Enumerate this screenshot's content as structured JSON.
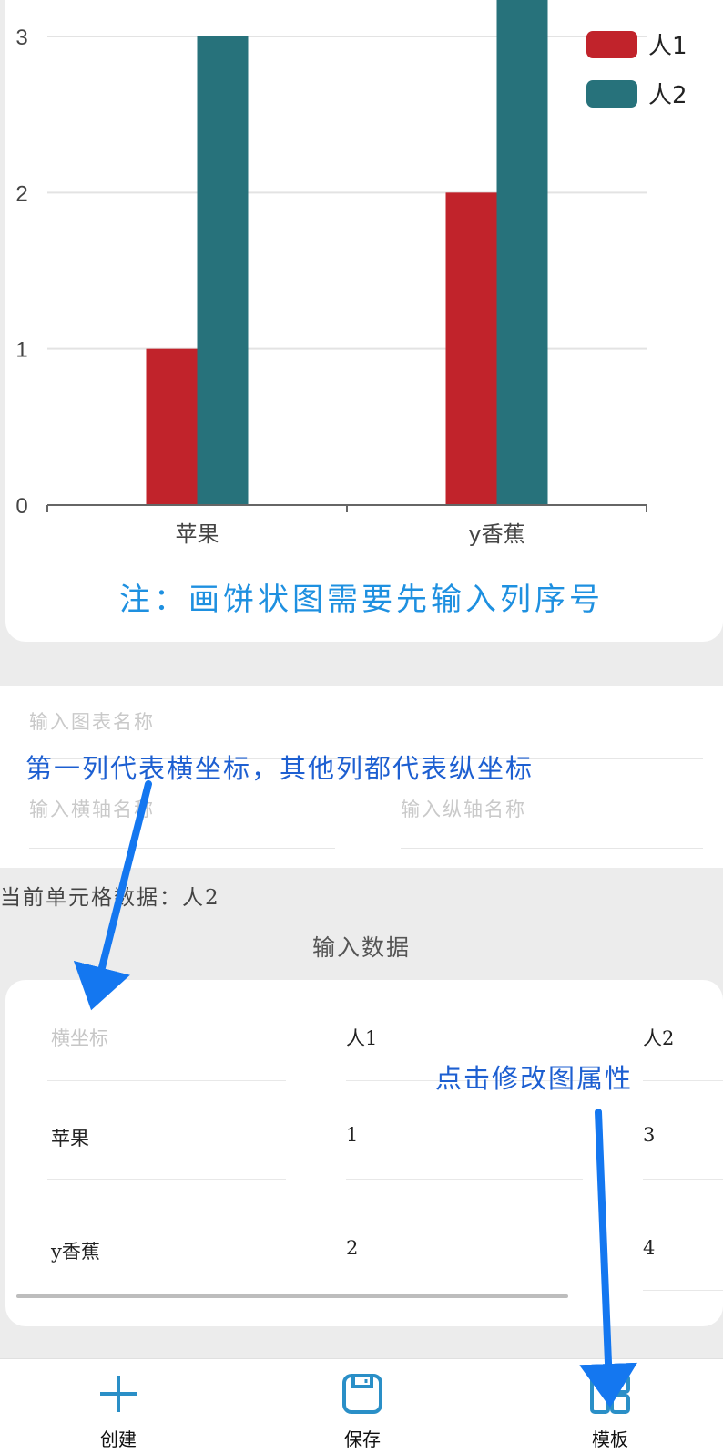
{
  "chart_data": {
    "type": "bar",
    "categories": [
      "苹果",
      "y香蕉"
    ],
    "series": [
      {
        "name": "人1",
        "values": [
          1,
          2
        ],
        "color": "#c1232b"
      },
      {
        "name": "人2",
        "values": [
          3,
          4
        ],
        "color": "#27727b"
      }
    ],
    "y_ticks": [
      "0",
      "1",
      "2",
      "3"
    ],
    "ylim": [
      0,
      3
    ],
    "grid": true,
    "legend_position": "top-right",
    "note": "注：画饼状图需要先输入列序号"
  },
  "form": {
    "chart_name_placeholder": "输入图表名称",
    "x_axis_placeholder": "输入横轴名称",
    "y_axis_placeholder": "输入纵轴名称",
    "annotation_columns": "第一列代表横坐标，其他列都代表纵坐标"
  },
  "cell_info": "当前单元格数据：人2",
  "data_section_title": "输入数据",
  "table": {
    "headers": [
      "横坐标",
      "人1",
      "人2"
    ],
    "rows": [
      [
        "苹果",
        "1",
        "3"
      ],
      [
        "y香蕉",
        "2",
        "4"
      ]
    ]
  },
  "annotation_edit": "点击修改图属性",
  "annotation_color": "#1477f0",
  "nav": [
    {
      "label": "创建",
      "icon": "plus-icon"
    },
    {
      "label": "保存",
      "icon": "save-icon"
    },
    {
      "label": "模板",
      "icon": "template-icon"
    }
  ],
  "accent": "#2a8fc7"
}
